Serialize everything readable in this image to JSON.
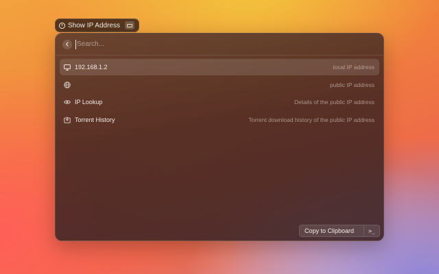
{
  "command": {
    "title": "Show IP Address",
    "icon": "clock-icon",
    "shortcut_icon": "keyboard-icon"
  },
  "search": {
    "placeholder": "Search...",
    "back_icon": "chevron-left-icon"
  },
  "items": [
    {
      "title": "192.168.1.2",
      "subtitle": "local IP address",
      "icon": "monitor-icon",
      "selected": true
    },
    {
      "title": "",
      "subtitle": "public IP address",
      "icon": "globe-icon",
      "selected": false
    },
    {
      "title": "IP Lookup",
      "subtitle": "Details of the public IP address",
      "icon": "eye-icon",
      "selected": false
    },
    {
      "title": "Torrent History",
      "subtitle": "Torrent download history of the public IP address",
      "icon": "download-box-icon",
      "selected": false
    }
  ],
  "footer": {
    "primary_action": "Copy to Clipboard",
    "secondary_icon": "terminal-icon",
    "secondary_label": ">_"
  },
  "colors": {
    "selected_row": "#5a3c34",
    "text": "#f1e9e4",
    "subtext": "#b9a59c"
  }
}
